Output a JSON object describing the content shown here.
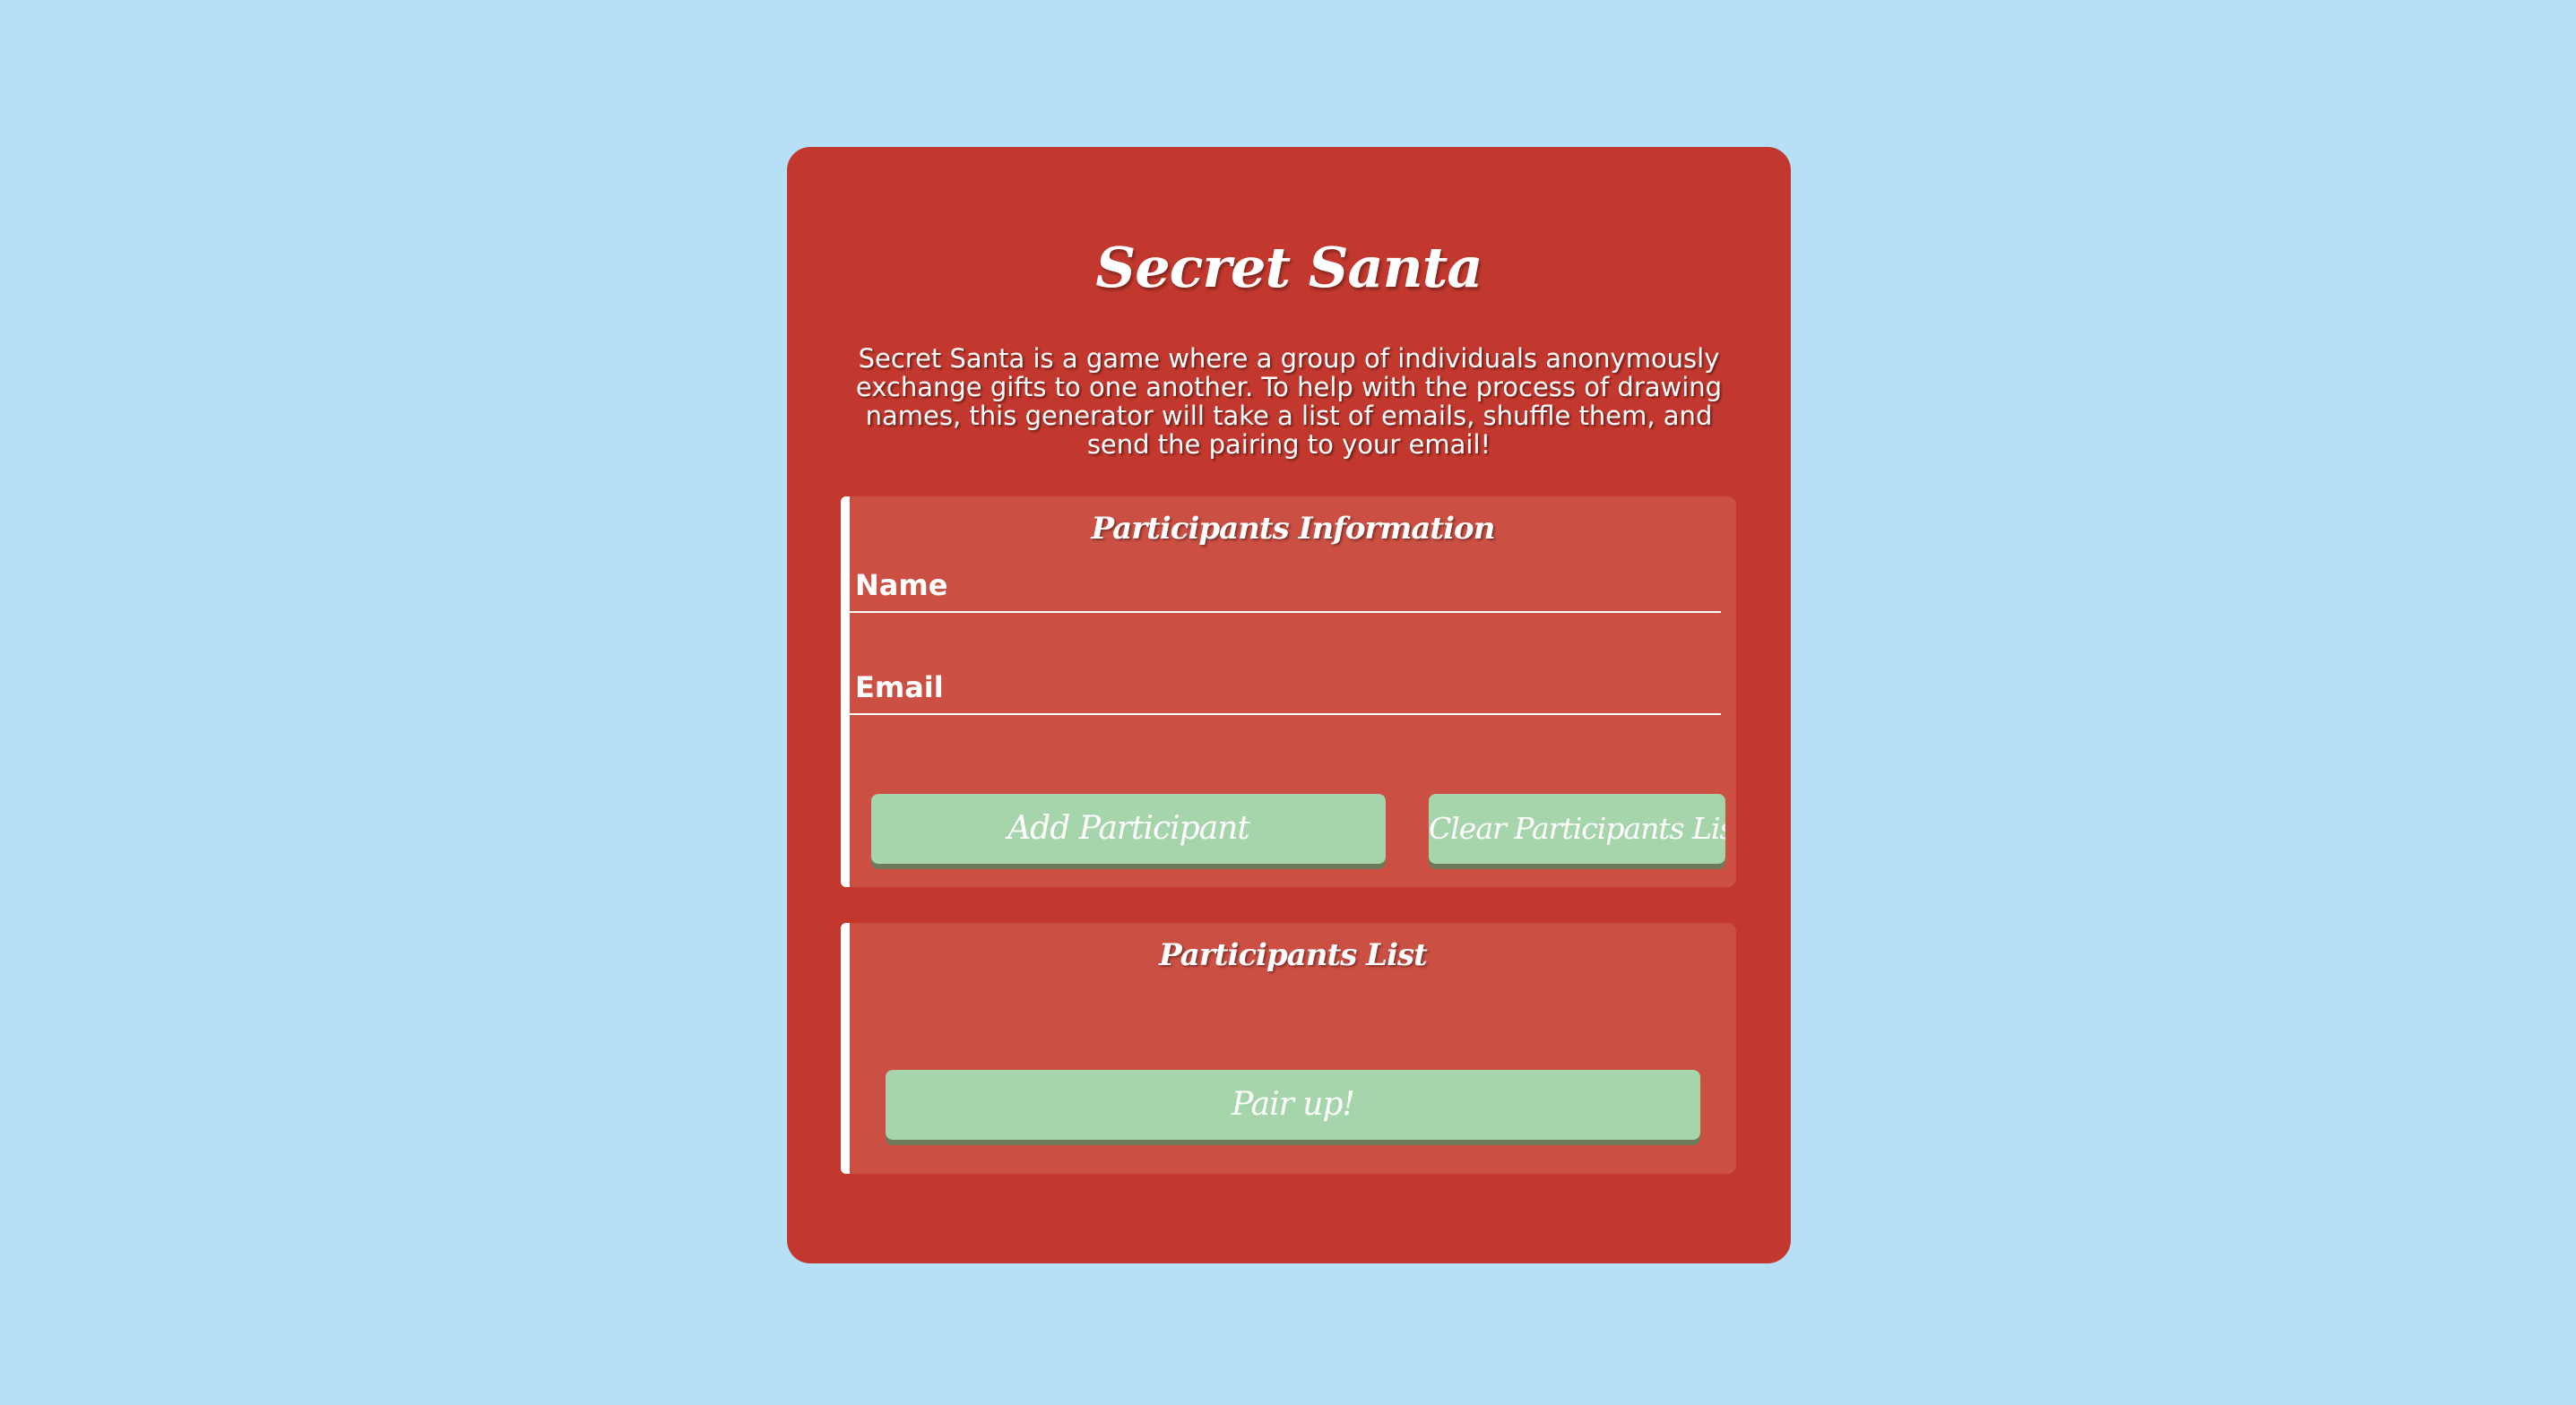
{
  "page": {
    "background_color": "#b6e0f6",
    "card_color": "#c3382e",
    "panel_color": "#cb4f43",
    "button_color": "#a7d5ab"
  },
  "header": {
    "title": "Secret Santa",
    "description": "Secret Santa is a game where a group of individuals anonymously exchange gifts to one another. To help with the process of drawing names, this generator will take a list of emails, shuffle them, and send the pairing to your email!"
  },
  "participants_info": {
    "title": "Participants Information",
    "name_field": {
      "placeholder": "Name",
      "value": ""
    },
    "email_field": {
      "placeholder": "Email",
      "value": ""
    },
    "add_button_label": "Add Participant",
    "clear_button_label": "Clear Participants List"
  },
  "participants_list": {
    "title": "Participants List",
    "items": [],
    "pair_button_label": "Pair up!"
  }
}
